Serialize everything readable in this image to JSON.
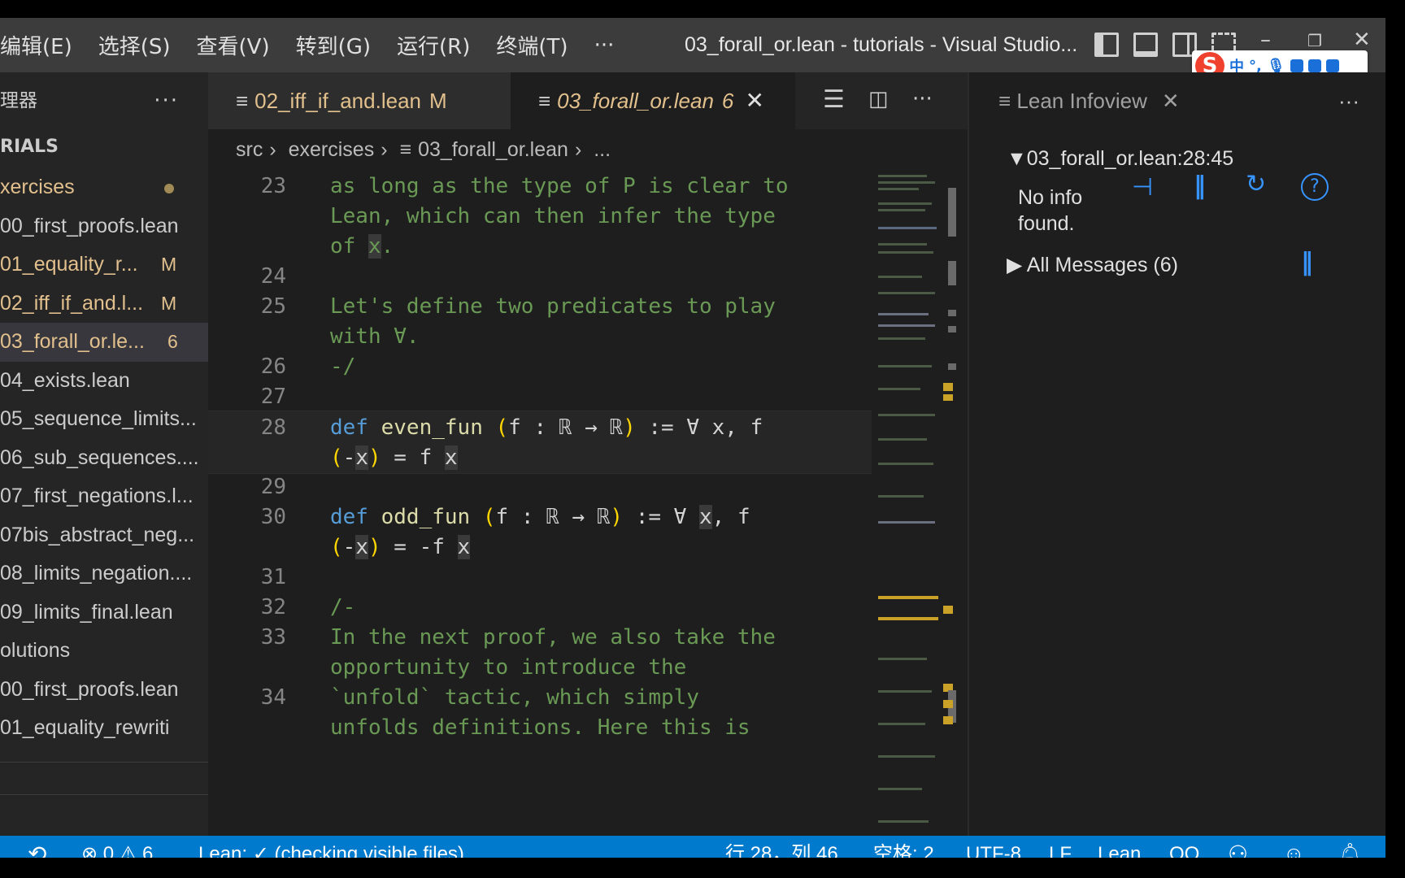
{
  "titlebar": {
    "menu": [
      "编辑(E)",
      "选择(S)",
      "查看(V)",
      "转到(G)",
      "运行(R)",
      "终端(T)"
    ],
    "more": "···",
    "window_title": "03_forall_or.lean - tutorials - Visual Studio...",
    "ime": {
      "lang": "中",
      "punct": "°,"
    }
  },
  "sidebar": {
    "header": "理器",
    "more": "···",
    "section": "RIALS",
    "items": [
      {
        "label": "xercises",
        "status": ""
      },
      {
        "label": "00_first_proofs.lean",
        "status": ""
      },
      {
        "label": "01_equality_r...",
        "status": "M"
      },
      {
        "label": "02_iff_if_and.l...",
        "status": "M"
      },
      {
        "label": "03_forall_or.le...",
        "status": "6"
      },
      {
        "label": "04_exists.lean",
        "status": ""
      },
      {
        "label": "05_sequence_limits...",
        "status": ""
      },
      {
        "label": "06_sub_sequences....",
        "status": ""
      },
      {
        "label": "07_first_negations.l...",
        "status": ""
      },
      {
        "label": "07bis_abstract_neg...",
        "status": ""
      },
      {
        "label": "08_limits_negation....",
        "status": ""
      },
      {
        "label": "09_limits_final.lean",
        "status": ""
      },
      {
        "label": "olutions",
        "status": ""
      },
      {
        "label": "00_first_proofs.lean",
        "status": ""
      },
      {
        "label": "01_equality_rewriti",
        "status": ""
      }
    ]
  },
  "editor": {
    "tabs": [
      {
        "label": "02_iff_if_and.lean",
        "badge": "M"
      },
      {
        "label": "03_forall_or.lean",
        "badge": "6",
        "close": "✕"
      }
    ],
    "breadcrumb": {
      "p1": "src",
      "p2": "exercises",
      "p3": "03_forall_or.lean",
      "p4": "...",
      "sep": "›"
    },
    "lines": {
      "l23": {
        "n": "23",
        "a": "as long as the type of P is clear to",
        "b": "Lean, which can then infer the type",
        "c1": "of ",
        "c2": "x",
        "c3": "."
      },
      "l24": {
        "n": "24"
      },
      "l25": {
        "n": "25",
        "a": "Let's define two predicates to play",
        "b": "with ∀."
      },
      "l26": {
        "n": "26",
        "a": "-/"
      },
      "l27": {
        "n": "27"
      },
      "l28": {
        "n": "28",
        "kw": "def",
        "name": "even_fun",
        "open": "(",
        "sig": "f : ℝ → ℝ",
        "close": ")",
        "rest": " := ∀ x, f",
        "w_open": "(",
        "w_mid": "-",
        "w_x": "x",
        "w_close": ")",
        "w_tail": " = f ",
        "w_x2": "x"
      },
      "l29": {
        "n": "29"
      },
      "l30": {
        "n": "30",
        "kw": "def",
        "name": "odd_fun",
        "open": "(",
        "sig": "f : ℝ → ℝ",
        "close": ")",
        "rest_a": " := ∀ ",
        "rest_x": "x",
        "rest_b": ", f",
        "w_open": "(",
        "w_mid": "-",
        "w_x": "x",
        "w_close": ")",
        "w_tail": " = -f ",
        "w_x2": "x"
      },
      "l31": {
        "n": "31"
      },
      "l32": {
        "n": "32",
        "a": "/-"
      },
      "l33": {
        "n": "33",
        "a": "In the next proof, we also take the",
        "b": "opportunity to introduce the"
      },
      "l34": {
        "n": "34",
        "a": "`unfold` tactic, which simply",
        "b": "unfolds definitions. Here this is"
      }
    }
  },
  "infoview": {
    "title": "Lean Infoview",
    "close": "✕",
    "more": "···",
    "location": "03_forall_or.lean:28:45",
    "no_info_1": "No info",
    "no_info_2": "found.",
    "all_messages": "All Messages (6)"
  },
  "statusbar": {
    "errors": "0",
    "warnings": "6",
    "lean_status": "Lean: ✓ (checking visible files)",
    "position": "行 28，列 46",
    "spaces": "空格: 2",
    "encoding": "UTF-8",
    "eol": "LF",
    "language": "Lean",
    "qq": "QQ"
  },
  "colors": {
    "statusbar": "#007acc",
    "modified": "#e2c08d",
    "comment": "#6a9955",
    "keyword": "#569cd6",
    "function": "#dcdcaa"
  }
}
